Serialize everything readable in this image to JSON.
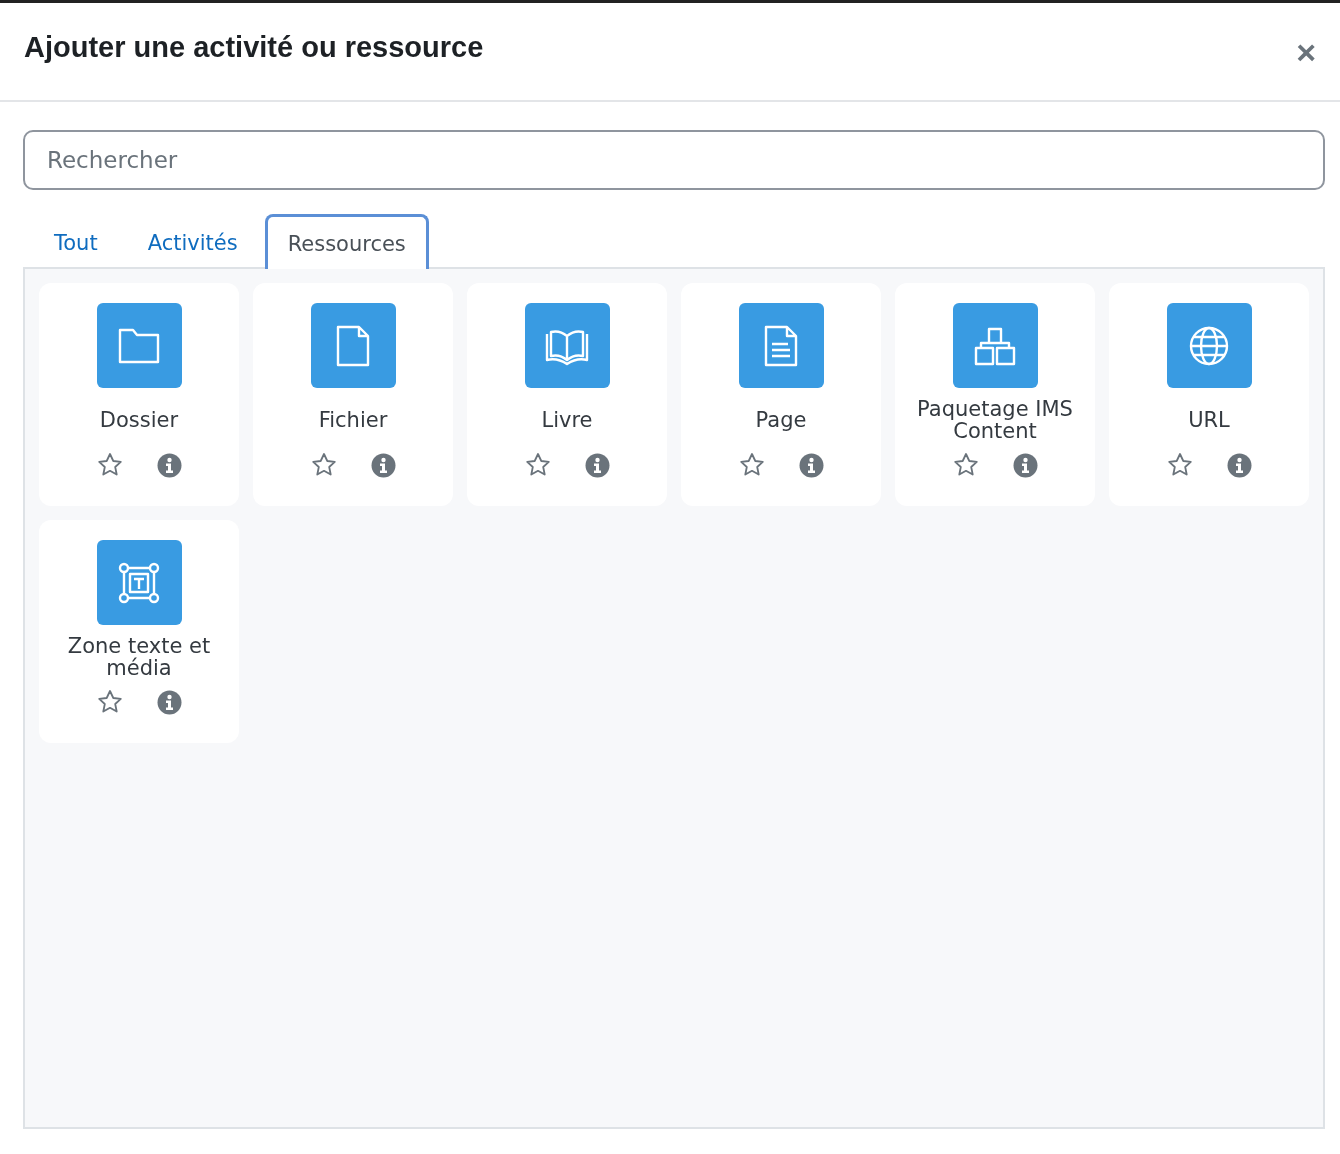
{
  "dialog": {
    "title": "Ajouter une activité ou ressource",
    "close": "×"
  },
  "search": {
    "placeholder": "Rechercher"
  },
  "tabs": [
    {
      "label": "Tout",
      "selected": false
    },
    {
      "label": "Activités",
      "selected": false
    },
    {
      "label": "Ressources",
      "selected": true
    }
  ],
  "items": [
    {
      "kind": "folder",
      "label": "Dossier",
      "starred": false
    },
    {
      "kind": "file",
      "label": "Fichier",
      "starred": false
    },
    {
      "kind": "book",
      "label": "Livre",
      "starred": false
    },
    {
      "kind": "page",
      "label": "Page",
      "starred": false
    },
    {
      "kind": "package",
      "label": "Paquetage IMS Content",
      "starred": false
    },
    {
      "kind": "globe",
      "label": "URL",
      "starred": false
    },
    {
      "kind": "textmedia",
      "label": "Zone texte et média",
      "starred": false
    }
  ]
}
